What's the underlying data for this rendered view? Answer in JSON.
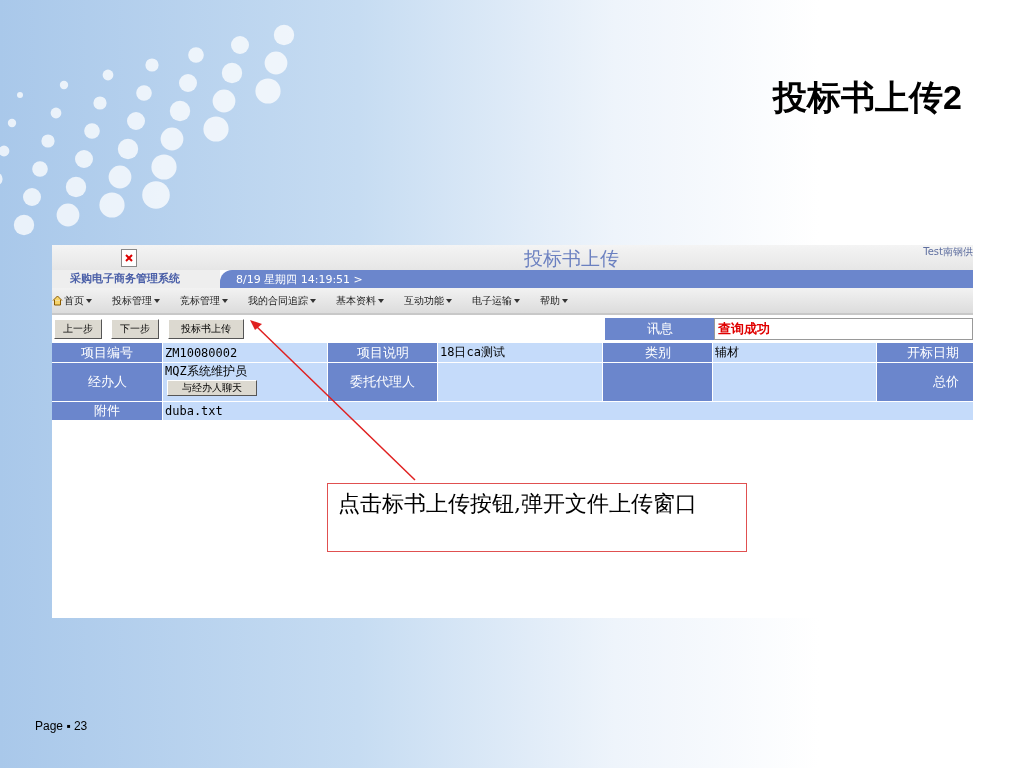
{
  "slide": {
    "title": "投标书上传2",
    "footer": "Page ▪ 23"
  },
  "screenshot": {
    "page_title": "投标书上传",
    "user": "Test南钢供",
    "system_name": "采购电子商务管理系统",
    "datetime": "8/19 星期四  14:19:51 >",
    "menu": [
      {
        "label": "首页",
        "kind": "home"
      },
      {
        "label": "投标管理",
        "kind": "menu"
      },
      {
        "label": "竞标管理",
        "kind": "menu"
      },
      {
        "label": "我的合同追踪",
        "kind": "menu"
      },
      {
        "label": "基本资料",
        "kind": "menu"
      },
      {
        "label": "互动功能",
        "kind": "menu"
      },
      {
        "label": "电子运输",
        "kind": "menu"
      },
      {
        "label": "帮助",
        "kind": "menu"
      }
    ],
    "toolbar_buttons": [
      "上一步",
      "下一步",
      "投标书上传"
    ],
    "message": {
      "label": "讯息",
      "value": "查询成功"
    },
    "rows": [
      [
        {
          "kind": "label",
          "text": "项目编号"
        },
        {
          "kind": "value",
          "text": "ZM10080002"
        },
        {
          "kind": "label",
          "text": "项目说明"
        },
        {
          "kind": "value",
          "text": "18日ca测试"
        },
        {
          "kind": "label",
          "text": "类别"
        },
        {
          "kind": "value",
          "text": "辅材"
        },
        {
          "kind": "label",
          "text": "开标日期"
        }
      ],
      [
        {
          "kind": "label",
          "text": "经办人"
        },
        {
          "kind": "value",
          "text": "MQZ系统维护员",
          "button": "与经办人聊天"
        },
        {
          "kind": "label",
          "text": "委托代理人"
        },
        {
          "kind": "value"
        },
        {
          "kind": "label"
        },
        {
          "kind": "value"
        },
        {
          "kind": "label",
          "text": "总价"
        }
      ],
      [
        {
          "kind": "label",
          "text": "附件"
        },
        {
          "kind": "value",
          "text": "duba.txt"
        }
      ]
    ]
  },
  "callout": {
    "text": "点击标书上传按钮,弹开文件上传窗口"
  }
}
